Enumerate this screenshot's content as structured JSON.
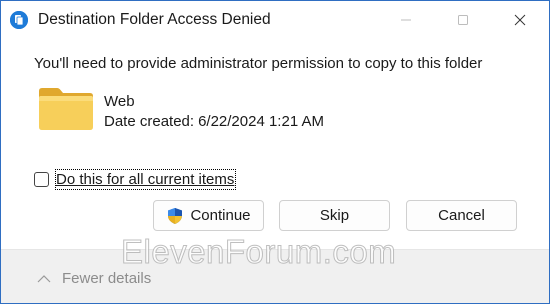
{
  "window": {
    "title": "Destination Folder Access Denied",
    "accent": "#2f6ec2"
  },
  "dialog": {
    "message": "You'll need to provide administrator permission to copy to this folder",
    "folder": {
      "name": "Web",
      "date_label": "Date created:",
      "date_value": "6/22/2024 1:21 AM",
      "icon": "folder-icon"
    },
    "checkbox": {
      "label": "Do this for all current items",
      "checked": false
    },
    "buttons": {
      "continue_label": "Continue",
      "skip_label": "Skip",
      "cancel_label": "Cancel"
    },
    "footer": {
      "details_label": "Fewer details"
    }
  },
  "watermark": {
    "text": "ElevenForum.com"
  }
}
